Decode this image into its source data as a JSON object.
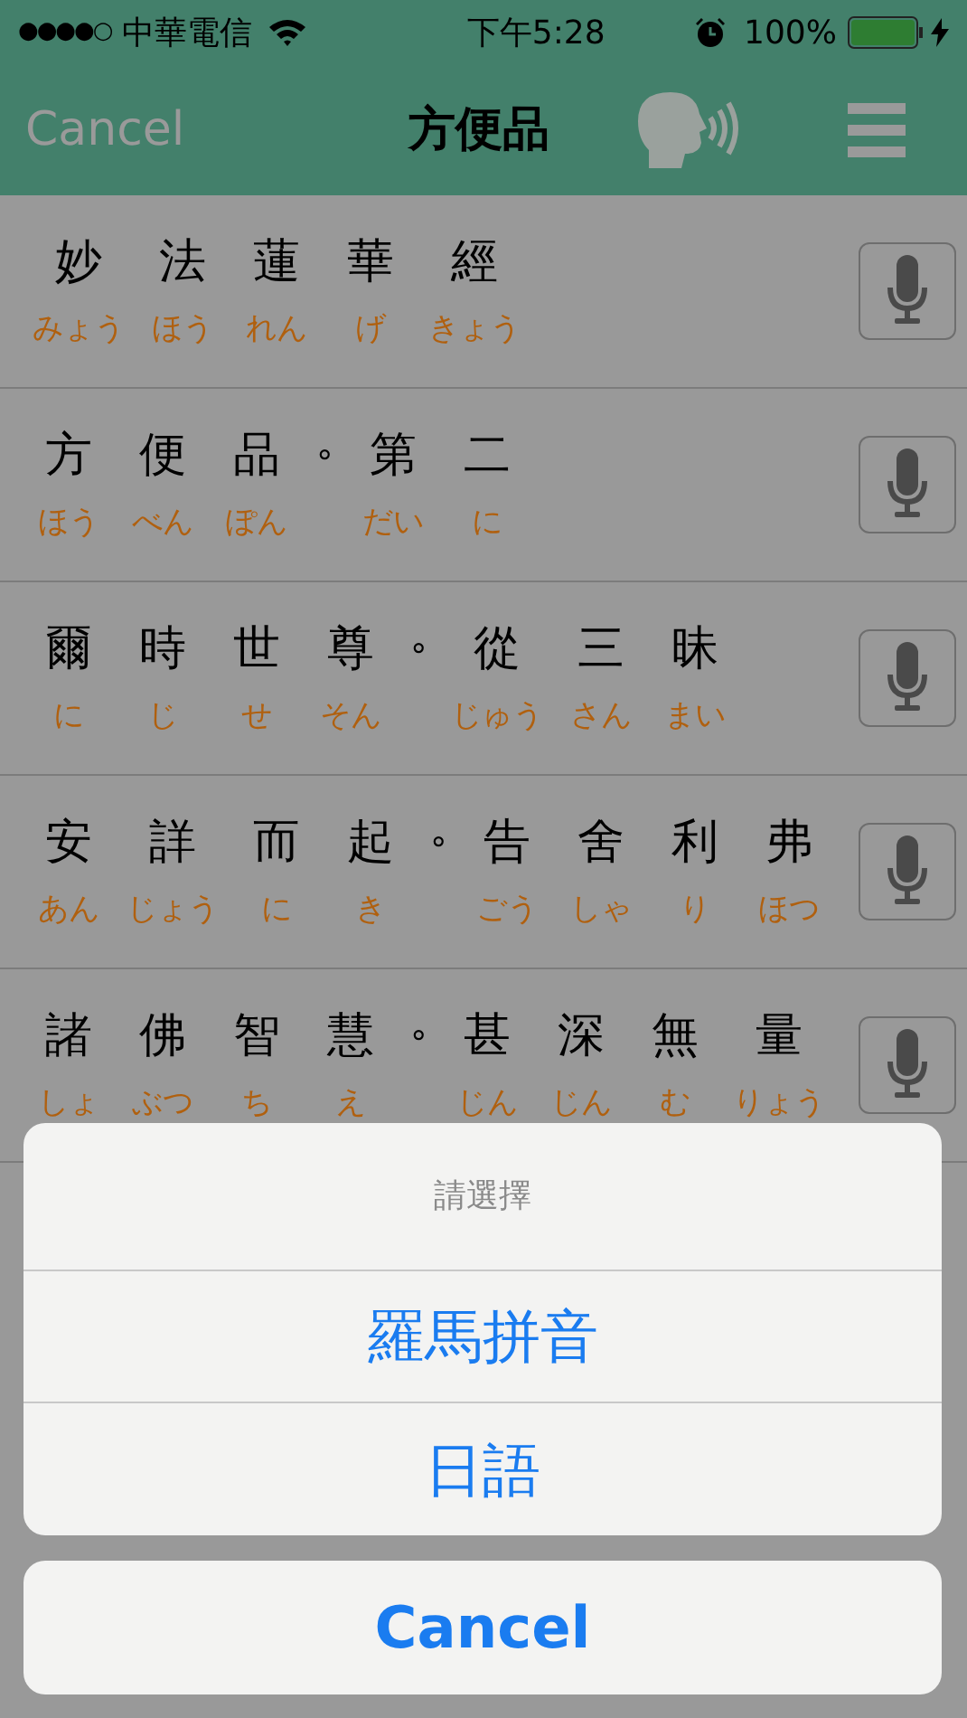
{
  "status_bar": {
    "signal": "●●●●○",
    "carrier": "中華電信",
    "time": "下午5:28",
    "battery": "100%"
  },
  "nav": {
    "cancel": "Cancel",
    "title": "方便品"
  },
  "verses": [
    {
      "cells": [
        {
          "kind": "char",
          "text": "妙",
          "reading": "みょう"
        },
        {
          "kind": "char",
          "text": "法",
          "reading": "ほう"
        },
        {
          "kind": "char",
          "text": "蓮",
          "reading": "れん"
        },
        {
          "kind": "char",
          "text": "華",
          "reading": "げ"
        },
        {
          "kind": "char",
          "text": "經",
          "reading": "きょう"
        }
      ]
    },
    {
      "cells": [
        {
          "kind": "char",
          "text": "方",
          "reading": "ほう"
        },
        {
          "kind": "char",
          "text": "便",
          "reading": "べん"
        },
        {
          "kind": "char",
          "text": "品",
          "reading": "ぽん"
        },
        {
          "kind": "mark",
          "text": "∘"
        },
        {
          "kind": "char",
          "text": "第",
          "reading": "だい"
        },
        {
          "kind": "char",
          "text": "二",
          "reading": "に"
        }
      ]
    },
    {
      "cells": [
        {
          "kind": "char",
          "text": "爾",
          "reading": "に"
        },
        {
          "kind": "char",
          "text": "時",
          "reading": "じ"
        },
        {
          "kind": "char",
          "text": "世",
          "reading": "せ"
        },
        {
          "kind": "char",
          "text": "尊",
          "reading": "そん"
        },
        {
          "kind": "mark",
          "text": "∘"
        },
        {
          "kind": "char",
          "text": "從",
          "reading": "じゅう"
        },
        {
          "kind": "char",
          "text": "三",
          "reading": "さん"
        },
        {
          "kind": "char",
          "text": "昧",
          "reading": "まい"
        }
      ]
    },
    {
      "cells": [
        {
          "kind": "char",
          "text": "安",
          "reading": "あん"
        },
        {
          "kind": "char",
          "text": "詳",
          "reading": "じょう"
        },
        {
          "kind": "char",
          "text": "而",
          "reading": "に"
        },
        {
          "kind": "char",
          "text": "起",
          "reading": "き"
        },
        {
          "kind": "mark",
          "text": "∘"
        },
        {
          "kind": "char",
          "text": "告",
          "reading": "ごう"
        },
        {
          "kind": "char",
          "text": "舍",
          "reading": "しゃ"
        },
        {
          "kind": "char",
          "text": "利",
          "reading": "り"
        },
        {
          "kind": "char",
          "text": "弗",
          "reading": "ほつ"
        }
      ]
    },
    {
      "cells": [
        {
          "kind": "char",
          "text": "諸",
          "reading": "しょ"
        },
        {
          "kind": "char",
          "text": "佛",
          "reading": "ぶつ"
        },
        {
          "kind": "char",
          "text": "智",
          "reading": "ち"
        },
        {
          "kind": "char",
          "text": "慧",
          "reading": "え"
        },
        {
          "kind": "mark",
          "text": "∘"
        },
        {
          "kind": "char",
          "text": "甚",
          "reading": "じん"
        },
        {
          "kind": "char",
          "text": "深",
          "reading": "じん"
        },
        {
          "kind": "char",
          "text": "無",
          "reading": "む"
        },
        {
          "kind": "char",
          "text": "量",
          "reading": "りょう"
        }
      ]
    }
  ],
  "action_sheet": {
    "title": "請選擇",
    "options": [
      "羅馬拼音",
      "日語"
    ],
    "cancel": "Cancel"
  }
}
